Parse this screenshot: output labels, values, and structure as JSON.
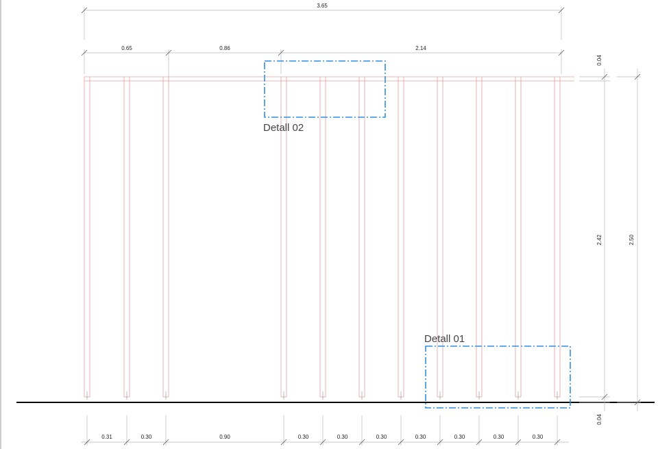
{
  "colors": {
    "stud": "#e0a0a0",
    "dimension": "#b8b8b8",
    "detail": "#2f8fe0",
    "ground": "#000000"
  },
  "top_dimensions": {
    "overall": "3.65",
    "segments": [
      "0.65",
      "0.86",
      "2.14"
    ]
  },
  "bottom_dimensions": [
    "0.31",
    "0.30",
    "0.90",
    "0.30",
    "0.30",
    "0.30",
    "0.30",
    "0.30",
    "0.30",
    "0.30"
  ],
  "right_dimensions": {
    "top_plate": "0.04",
    "wall_height": "2.42",
    "overall_height": "2.50",
    "bottom_plate": "0.04"
  },
  "details": {
    "detail_01": "Detall 01",
    "detail_02": "Detall 02"
  }
}
